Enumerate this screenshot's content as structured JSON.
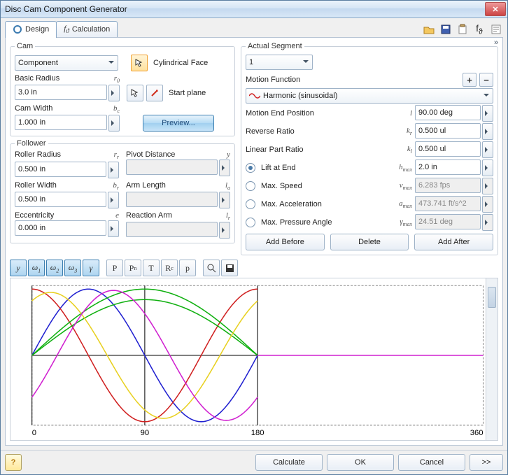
{
  "window": {
    "title": "Disc Cam Component Generator"
  },
  "tabs": {
    "design": "Design",
    "calculation": "Calculation"
  },
  "cam": {
    "legend": "Cam",
    "component_label": "Component",
    "basic_radius_label": "Basic Radius",
    "basic_radius_sym": "r₀",
    "basic_radius_val": "3.0 in",
    "cam_width_label": "Cam Width",
    "cam_width_sym": "bc",
    "cam_width_val": "1.000 in",
    "cyl_face": "Cylindrical Face",
    "start_plane": "Start plane",
    "preview": "Preview..."
  },
  "follower": {
    "legend": "Follower",
    "roller_radius_label": "Roller Radius",
    "roller_radius_sym": "rᵣ",
    "roller_radius_val": "0.500 in",
    "roller_width_label": "Roller Width",
    "roller_width_sym": "bᵣ",
    "roller_width_val": "0.500 in",
    "ecc_label": "Eccentricity",
    "ecc_sym": "e",
    "ecc_val": "0.000 in",
    "pivot_label": "Pivot Distance",
    "pivot_sym": "y",
    "pivot_val": "",
    "arm_label": "Arm Length",
    "arm_sym": "la",
    "arm_val": "",
    "react_label": "Reaction Arm",
    "react_sym": "lᵣ",
    "react_val": ""
  },
  "segment": {
    "legend": "Actual Segment",
    "sel": "1",
    "motion_fn_label": "Motion Function",
    "motion_fn_val": "Harmonic (sinusoidal)",
    "end_pos_label": "Motion End Position",
    "end_pos_sym": "l",
    "end_pos_val": "90.00 deg",
    "rev_ratio_label": "Reverse Ratio",
    "rev_ratio_sym": "kᵣ",
    "rev_ratio_val": "0.500 ul",
    "lin_ratio_label": "Linear Part Ratio",
    "lin_ratio_sym": "kₗ",
    "lin_ratio_val": "0.500 ul",
    "opt_lift": "Lift at End",
    "opt_lift_sym": "hmax",
    "opt_lift_val": "2.0 in",
    "opt_speed": "Max. Speed",
    "opt_speed_sym": "vmax",
    "opt_speed_val": "6.283 fps",
    "opt_acc": "Max. Acceleration",
    "opt_acc_sym": "amax",
    "opt_acc_val": "473.741 ft/s^2",
    "opt_press": "Max. Pressure Angle",
    "opt_press_sym": "γmax",
    "opt_press_val": "24.51 deg",
    "add_before": "Add Before",
    "delete": "Delete",
    "add_after": "Add After"
  },
  "axis": {
    "t0": "0",
    "t90": "90",
    "t180": "180",
    "t360": "360"
  },
  "footer": {
    "calculate": "Calculate",
    "ok": "OK",
    "cancel": "Cancel",
    "expand": ">>"
  },
  "chart_data": {
    "type": "line",
    "xlabel": "",
    "ylabel": "",
    "xlim": [
      0,
      360
    ],
    "x_ticks": [
      0,
      90,
      180,
      360
    ],
    "description": "Motion curves for harmonic (sinusoidal) cam segments 0–180° (lift, velocity ω, acceleration ω², pressure angle γ); flat 180–360°",
    "series": [
      {
        "name": "red",
        "color": "#d02020"
      },
      {
        "name": "blue",
        "color": "#2020d0"
      },
      {
        "name": "green",
        "color": "#10b010"
      },
      {
        "name": "yellow",
        "color": "#e8d020"
      },
      {
        "name": "magenta",
        "color": "#d020d0"
      }
    ]
  }
}
